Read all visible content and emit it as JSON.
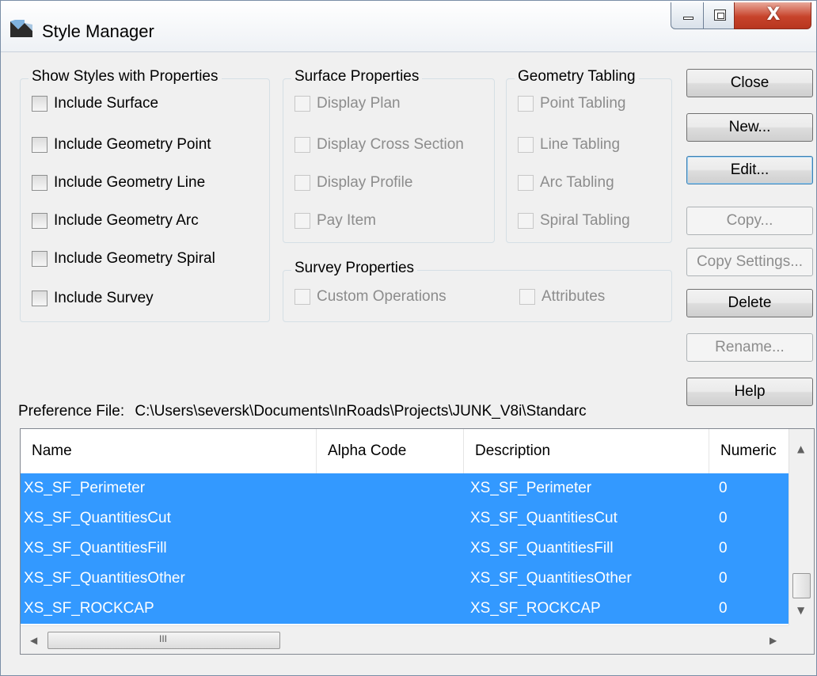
{
  "window": {
    "title": "Style Manager",
    "close_glyph": "X"
  },
  "show_styles": {
    "legend": "Show Styles with Properties",
    "items": [
      {
        "label": "Include Surface",
        "checked": false
      },
      {
        "label": "Include Geometry Point",
        "checked": false
      },
      {
        "label": "Include Geometry Line",
        "checked": false
      },
      {
        "label": "Include Geometry Arc",
        "checked": false
      },
      {
        "label": "Include Geometry Spiral",
        "checked": false
      },
      {
        "label": "Include Survey",
        "checked": false
      }
    ]
  },
  "surface_properties": {
    "legend": "Surface Properties",
    "items": [
      {
        "label": "Display Plan",
        "enabled": false
      },
      {
        "label": "Display Cross Section",
        "enabled": false
      },
      {
        "label": "Display Profile",
        "enabled": false
      },
      {
        "label": "Pay Item",
        "enabled": false
      }
    ]
  },
  "geometry_tabling": {
    "legend": "Geometry Tabling",
    "items": [
      {
        "label": "Point Tabling",
        "enabled": false
      },
      {
        "label": "Line Tabling",
        "enabled": false
      },
      {
        "label": "Arc Tabling",
        "enabled": false
      },
      {
        "label": "Spiral Tabling",
        "enabled": false
      }
    ]
  },
  "survey_properties": {
    "legend": "Survey Properties",
    "items": [
      {
        "label": "Custom Operations",
        "enabled": false
      },
      {
        "label": "Attributes",
        "enabled": false
      }
    ]
  },
  "buttons": {
    "close": "Close",
    "new": "New...",
    "edit": "Edit...",
    "copy": "Copy...",
    "copy_settings": "Copy Settings...",
    "delete": "Delete",
    "rename": "Rename...",
    "help": "Help"
  },
  "preference": {
    "label": "Preference File:",
    "path": "C:\\Users\\seversk\\Documents\\InRoads\\Projects\\JUNK_V8i\\Standarc"
  },
  "list": {
    "columns": [
      "Name",
      "Alpha Code",
      "Description",
      "Numeric"
    ],
    "rows": [
      {
        "name": "XS_SF_Perimeter",
        "alpha": "",
        "description": "XS_SF_Perimeter",
        "numeric": "0",
        "selected": true
      },
      {
        "name": "XS_SF_QuantitiesCut",
        "alpha": "",
        "description": "XS_SF_QuantitiesCut",
        "numeric": "0",
        "selected": true
      },
      {
        "name": "XS_SF_QuantitiesFill",
        "alpha": "",
        "description": "XS_SF_QuantitiesFill",
        "numeric": "0",
        "selected": true
      },
      {
        "name": "XS_SF_QuantitiesOther",
        "alpha": "",
        "description": "XS_SF_QuantitiesOther",
        "numeric": "0",
        "selected": true
      },
      {
        "name": "XS_SF_ROCKCAP",
        "alpha": "",
        "description": "XS_SF_ROCKCAP",
        "numeric": "0",
        "selected": true
      }
    ],
    "hscroll_grip": "III"
  },
  "colors": {
    "selection": "#3399ff",
    "close_button": "#c7432b"
  }
}
